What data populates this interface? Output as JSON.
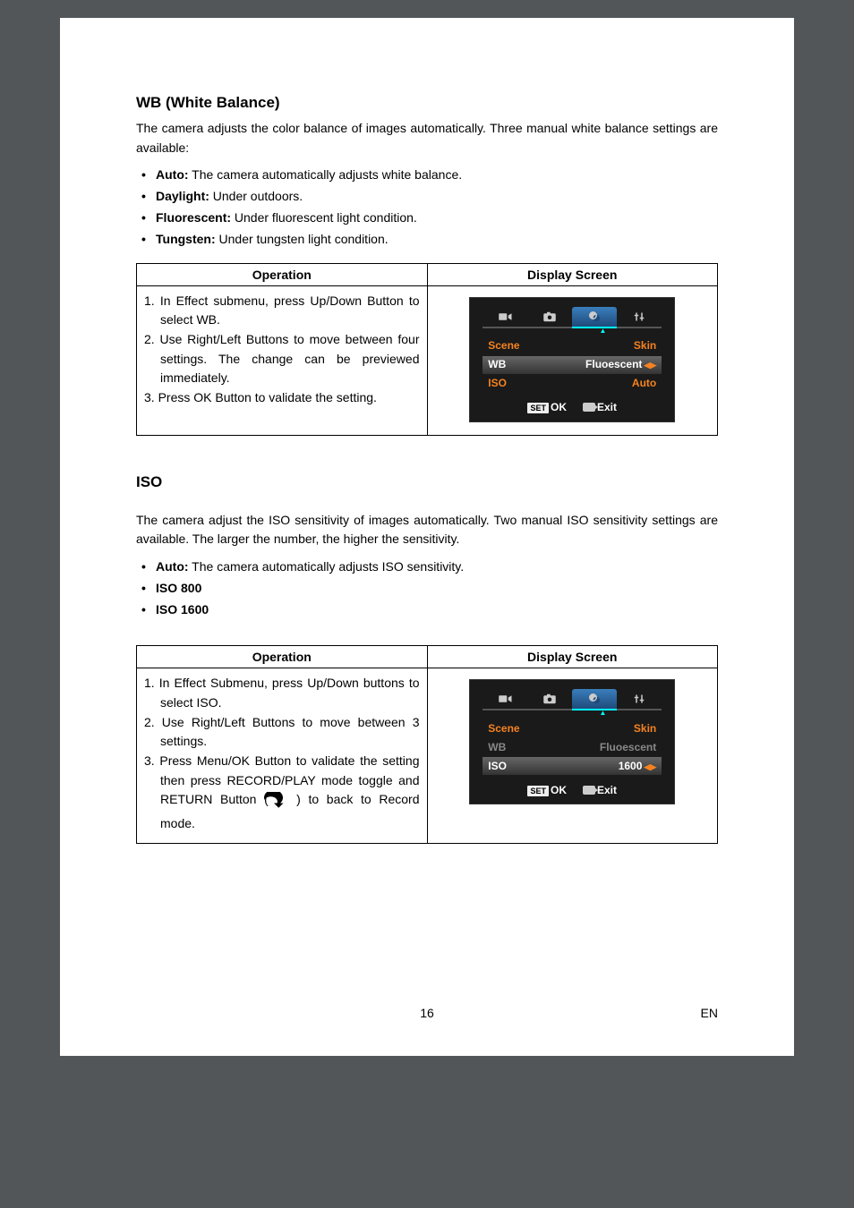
{
  "wb": {
    "heading": "WB (White Balance)",
    "intro": "The camera adjusts the color balance of images automatically. Three manual white balance settings are available:",
    "items": [
      {
        "term": "Auto:",
        "desc": " The camera automatically adjusts white balance."
      },
      {
        "term": "Daylight:",
        "desc": " Under outdoors."
      },
      {
        "term": "Fluorescent:",
        "desc": " Under fluorescent light condition."
      },
      {
        "term": "Tungsten:",
        "desc": " Under tungsten light condition."
      }
    ],
    "th1": "Operation",
    "th2": "Display Screen",
    "steps": [
      "1. In Effect submenu, press Up/Down Button to select WB.",
      "2. Use Right/Left Buttons to move between four settings. The change can be previewed immediately.",
      "3. Press OK Button to validate the setting."
    ],
    "screen": {
      "rows": [
        {
          "lab": "Scene",
          "val": "Skin",
          "hl": false,
          "dim": false
        },
        {
          "lab": "WB",
          "val": "Fluoescent",
          "hl": true,
          "dim": false,
          "arrow": true
        },
        {
          "lab": "ISO",
          "val": "Auto",
          "hl": false,
          "dim": false
        }
      ],
      "ok": "OK",
      "exit": "Exit",
      "set": "SET"
    }
  },
  "iso": {
    "heading": "ISO",
    "intro": "The camera adjust the ISO sensitivity of images automatically. Two manual ISO sensitivity settings are available. The larger the number, the higher the sensitivity.",
    "items": [
      {
        "term": "Auto:",
        "desc": " The camera automatically adjusts ISO sensitivity."
      },
      {
        "term": "ISO 800",
        "desc": ""
      },
      {
        "term": "ISO 1600",
        "desc": ""
      }
    ],
    "th1": "Operation",
    "th2": "Display Screen",
    "steps": [
      "1. In Effect Submenu, press Up/Down buttons to select ISO.",
      "2. Use Right/Left Buttons to move between 3 settings.",
      "3. Press Menu/OK Button to validate the setting then press RECORD/PLAY mode toggle and RETURN Button ( "
    ],
    "step3_tail": " ) to back to Record mode.",
    "screen": {
      "rows": [
        {
          "lab": "Scene",
          "val": "Skin",
          "hl": false,
          "dim": false
        },
        {
          "lab": "WB",
          "val": "Fluoescent",
          "hl": false,
          "dim": true
        },
        {
          "lab": "ISO",
          "val": "1600",
          "hl": true,
          "dim": false,
          "arrow": true
        }
      ],
      "ok": "OK",
      "exit": "Exit",
      "set": "SET"
    }
  },
  "footer": {
    "page": "16",
    "lang": "EN"
  }
}
